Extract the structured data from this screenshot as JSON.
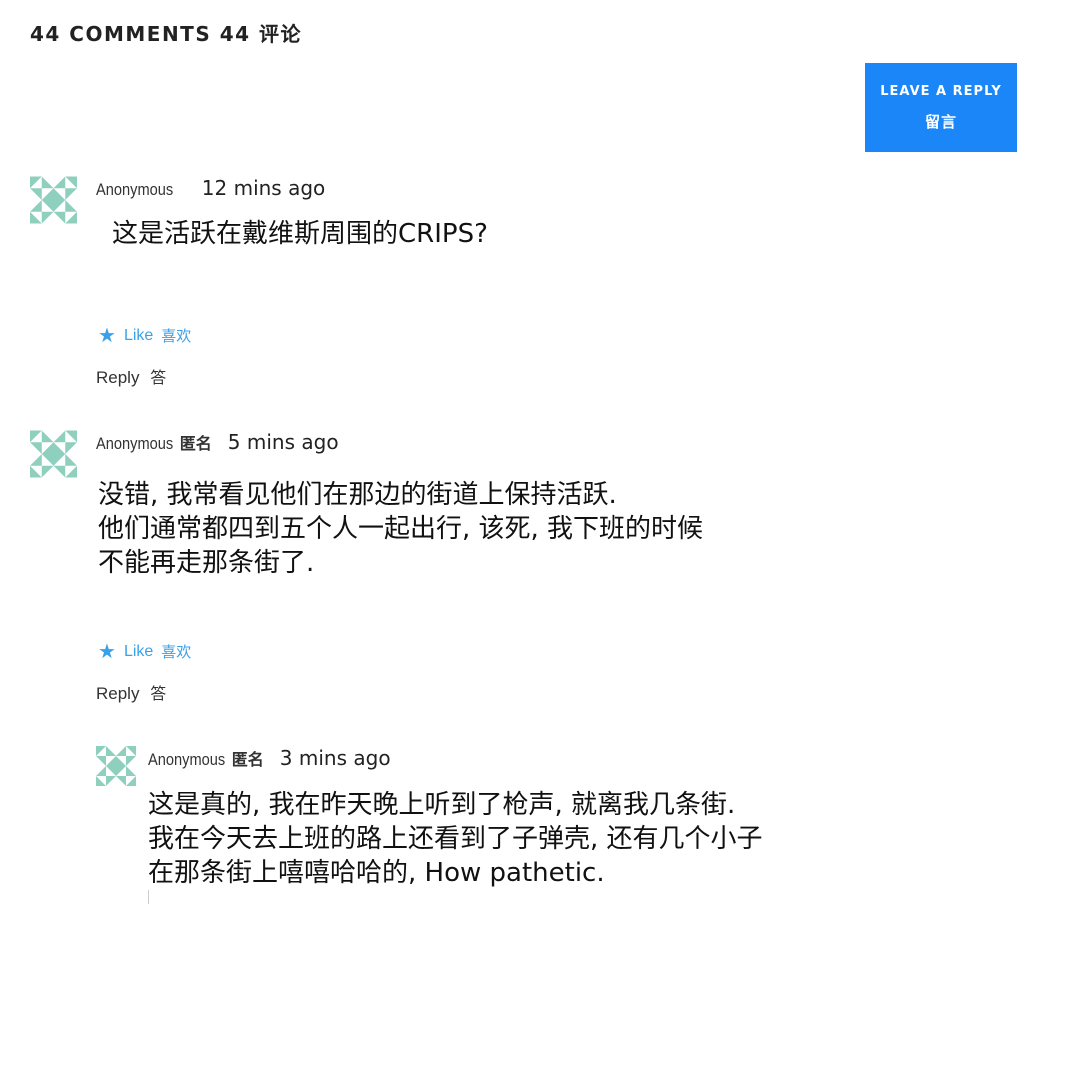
{
  "header": {
    "comments_count_label": "44 COMMENTS 44 评论"
  },
  "leave_reply": {
    "label_en": "LEAVE A REPLY",
    "label_cn": "留言"
  },
  "colors": {
    "accent": "#1a86f7",
    "like": "#3aa1e9",
    "avatar_teal": "#8fcfbe"
  },
  "comments": [
    {
      "author": "Anonymous",
      "author_cn": "",
      "time": "12 mins ago",
      "lines": [
        "这是活跃在戴维斯周围的CRIPS?"
      ],
      "like_label": "Like",
      "like_cn": "喜欢",
      "reply_label": "Reply",
      "reply_cn": "答",
      "like_icon": "star-icon"
    },
    {
      "author": "Anonymous",
      "author_cn": "匿名",
      "time": "5 mins ago",
      "lines": [
        "没错, 我常看见他们在那边的街道上保持活跃.",
        "他们通常都四到五个人一起出行, 该死, 我下班的时候",
        "不能再走那条街了."
      ],
      "like_label": "Like",
      "like_cn": "喜欢",
      "reply_label": "Reply",
      "reply_cn": "答",
      "like_icon": "star-icon"
    },
    {
      "author": "Anonymous",
      "author_cn": "匿名",
      "time": "3 mins ago",
      "lines": [
        "这是真的, 我在昨天晚上听到了枪声, 就离我几条街.",
        "我在今天去上班的路上还看到了子弹壳, 还有几个小子",
        "在那条街上嘻嘻哈哈的, How pathetic."
      ]
    }
  ]
}
